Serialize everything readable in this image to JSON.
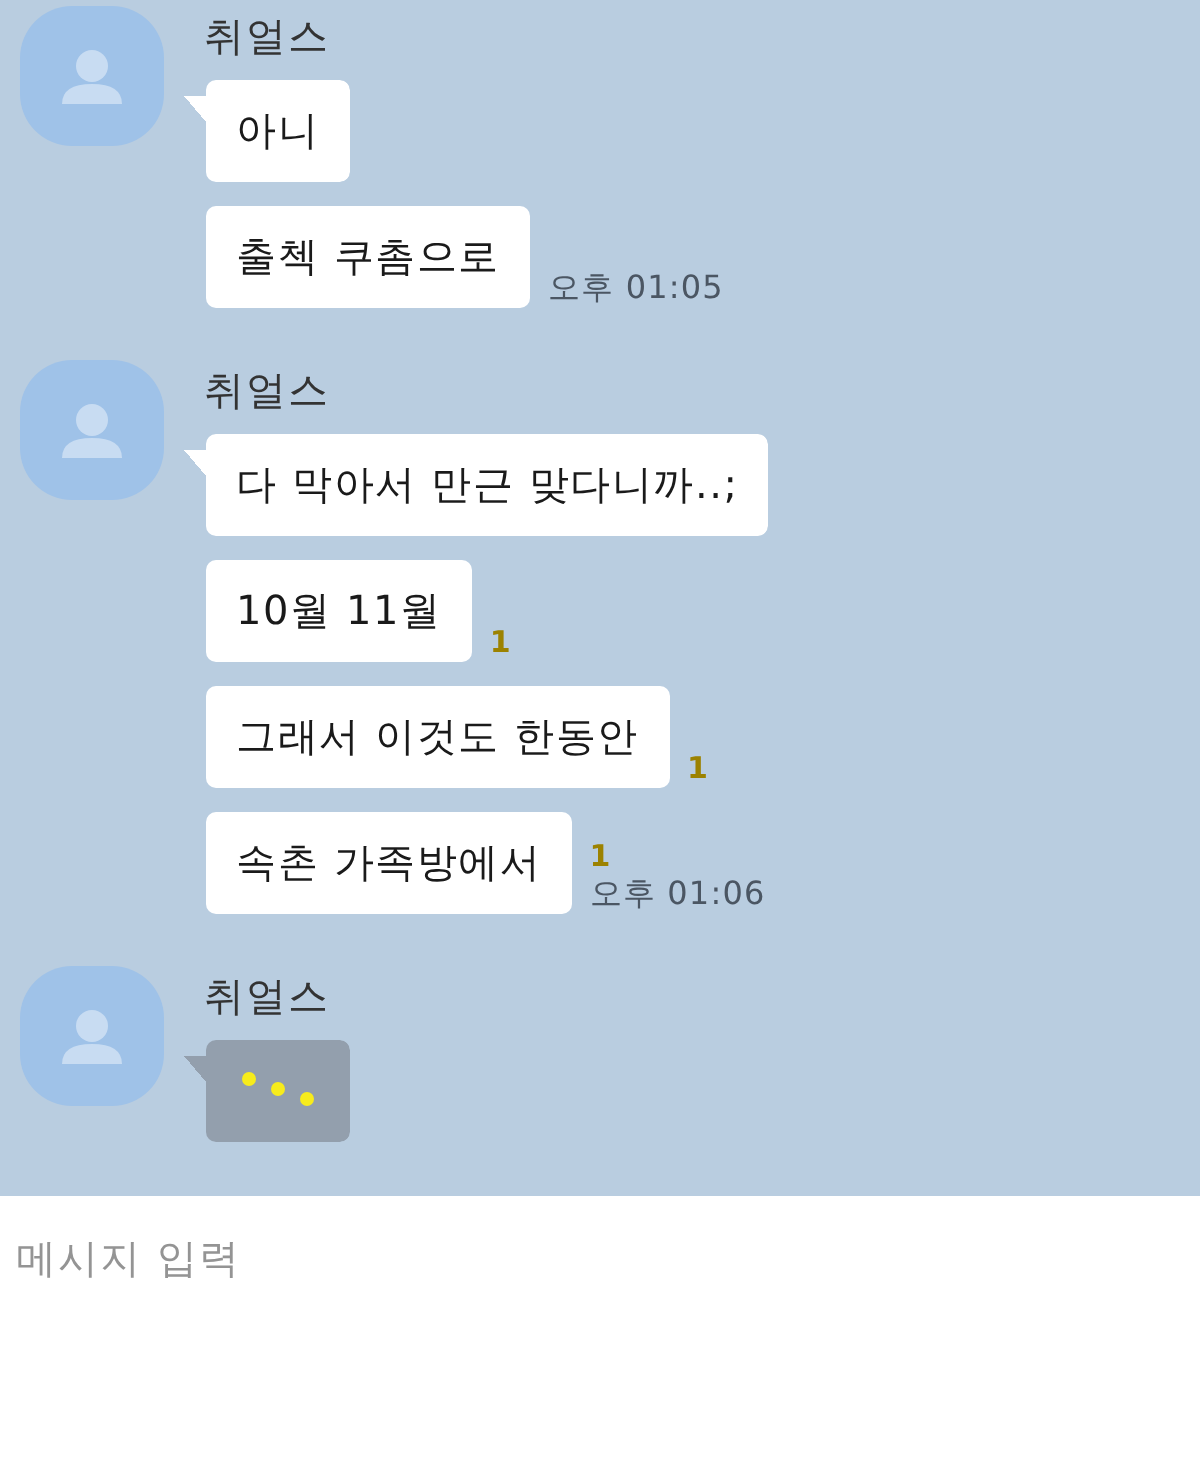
{
  "chat": {
    "groups": [
      {
        "sender": "취얼스",
        "messages": [
          {
            "kind": "text",
            "text": "아니"
          },
          {
            "kind": "text",
            "text": "출첵 쿠촘으로",
            "time": "오후 01:05"
          }
        ]
      },
      {
        "sender": "취얼스",
        "messages": [
          {
            "kind": "text",
            "text": "다 막아서 만근 맞다니까..;"
          },
          {
            "kind": "text",
            "text": "10월 11월",
            "unread": "1"
          },
          {
            "kind": "text",
            "text": "그래서 이것도 한동안",
            "unread": "1"
          },
          {
            "kind": "text",
            "text": "속촌 가족방에서",
            "unread": "1",
            "time": "오후 01:06"
          }
        ]
      },
      {
        "sender": "취얼스",
        "messages": [
          {
            "kind": "typing"
          }
        ]
      }
    ]
  },
  "composer": {
    "placeholder": "메시지 입력"
  }
}
